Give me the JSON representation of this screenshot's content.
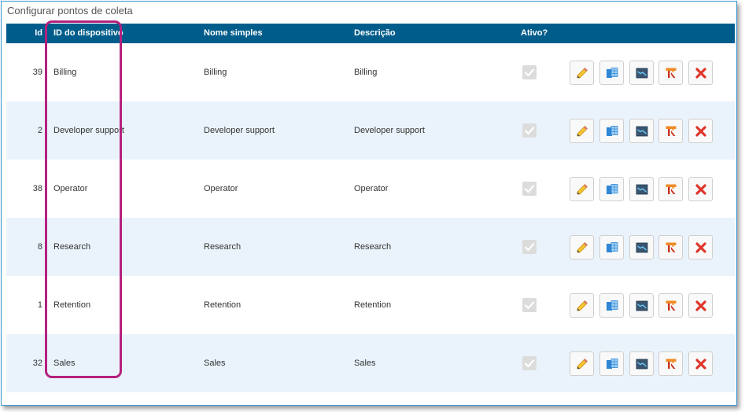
{
  "panel": {
    "title": "Configurar pontos de coleta"
  },
  "columns": {
    "id": "Id",
    "device_id": "ID do dispositivo",
    "simple_name": "Nome simples",
    "description": "Descrição",
    "active": "Ativo?"
  },
  "rows": [
    {
      "id": "39",
      "device_id": "Billing",
      "simple_name": "Billing",
      "description": "Billing",
      "active": true
    },
    {
      "id": "2",
      "device_id": "Developer support",
      "simple_name": "Developer support",
      "description": "Developer support",
      "active": true
    },
    {
      "id": "38",
      "device_id": "Operator",
      "simple_name": "Operator",
      "description": "Operator",
      "active": true
    },
    {
      "id": "8",
      "device_id": "Research",
      "simple_name": "Research",
      "description": "Research",
      "active": true
    },
    {
      "id": "1",
      "device_id": "Retention",
      "simple_name": "Retention",
      "description": "Retention",
      "active": true
    },
    {
      "id": "32",
      "device_id": "Sales",
      "simple_name": "Sales",
      "description": "Sales",
      "active": true
    }
  ],
  "row_actions": [
    "pencil-icon",
    "columns-icon",
    "chart-icon",
    "report-icon",
    "delete-x-icon"
  ],
  "colors": {
    "header_bg": "#005c8b",
    "row_alt_bg": "#eaf3fb",
    "highlight": "#b5217e",
    "frame_border": "#3c9bd2",
    "delete": "#e0352b"
  }
}
